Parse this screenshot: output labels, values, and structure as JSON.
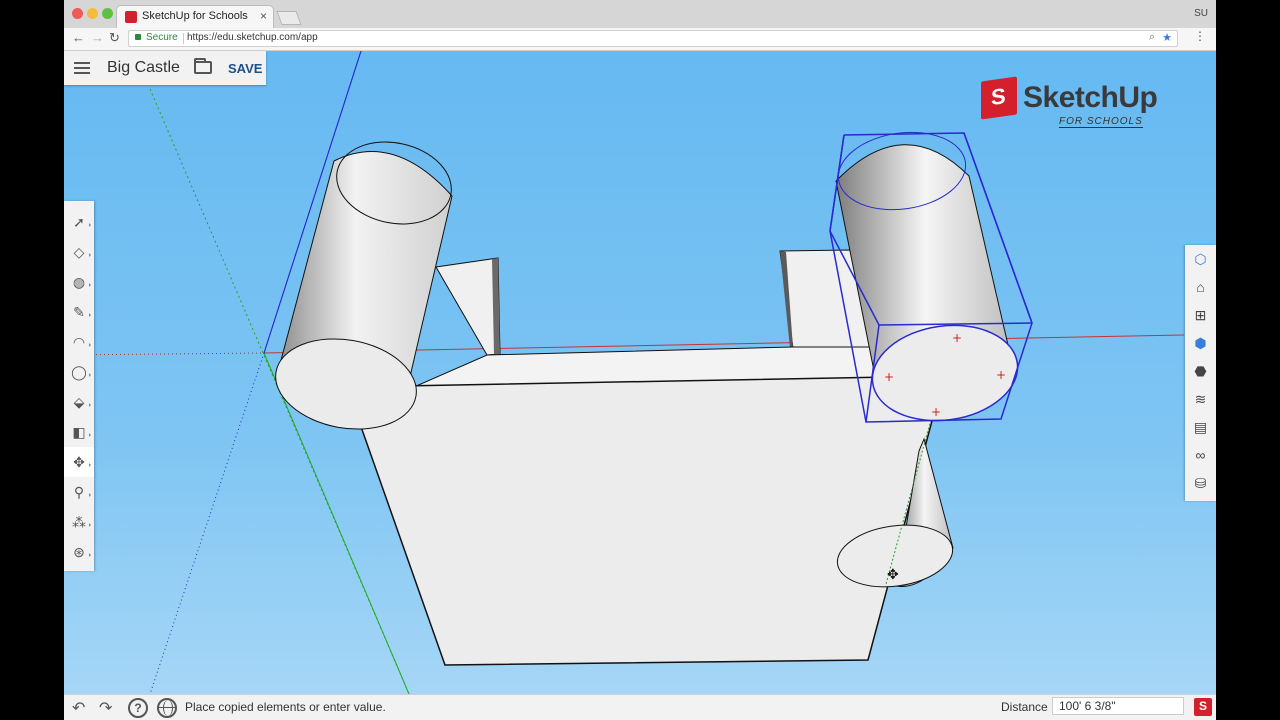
{
  "browser": {
    "tab_title": "SketchUp for Schools",
    "profile": "SU",
    "secure_label": "Secure",
    "url": "https://edu.sketchup.com/app"
  },
  "app": {
    "model_title": "Big Castle",
    "save_label": "SAVE",
    "logo_text": "SketchUp",
    "logo_subtitle": "FOR SCHOOLS"
  },
  "left_toolbar": {
    "tools": [
      {
        "name": "select-tool",
        "icon": "arrow-icon"
      },
      {
        "name": "eraser-tool",
        "icon": "eraser-icon"
      },
      {
        "name": "paint-tool",
        "icon": "paint-bucket-icon"
      },
      {
        "name": "line-tool",
        "icon": "pencil-icon"
      },
      {
        "name": "arc-tool",
        "icon": "arc-icon"
      },
      {
        "name": "circle-tool",
        "icon": "circle-icon"
      },
      {
        "name": "push-pull-tool",
        "icon": "push-pull-icon"
      },
      {
        "name": "offset-tool",
        "icon": "offset-icon"
      },
      {
        "name": "move-tool",
        "icon": "move-icon",
        "active": true
      },
      {
        "name": "tape-measure-tool",
        "icon": "tape-icon"
      },
      {
        "name": "walk-tool",
        "icon": "footprints-icon"
      },
      {
        "name": "orbit-tool",
        "icon": "orbit-icon"
      }
    ]
  },
  "right_toolbar": {
    "panels": [
      {
        "name": "entity-info",
        "icon": "cube-info-icon"
      },
      {
        "name": "instructor",
        "icon": "graduation-cap-icon"
      },
      {
        "name": "components",
        "icon": "components-icon"
      },
      {
        "name": "styles",
        "icon": "styles-cube-icon"
      },
      {
        "name": "materials",
        "icon": "materials-icon"
      },
      {
        "name": "layers",
        "icon": "layers-icon"
      },
      {
        "name": "scenes",
        "icon": "clapper-icon"
      },
      {
        "name": "display",
        "icon": "glasses-icon"
      },
      {
        "name": "3d-warehouse",
        "icon": "warehouse-icon"
      }
    ]
  },
  "status": {
    "message": "Place copied elements or enter value.",
    "measure_label": "Distance",
    "measure_value": "100' 6 3/8\""
  },
  "colors": {
    "accent": "#1e4f8a",
    "brand_red": "#d4202c",
    "sky_top": "#66b9f2",
    "sky_bottom": "#a6d6f6"
  }
}
